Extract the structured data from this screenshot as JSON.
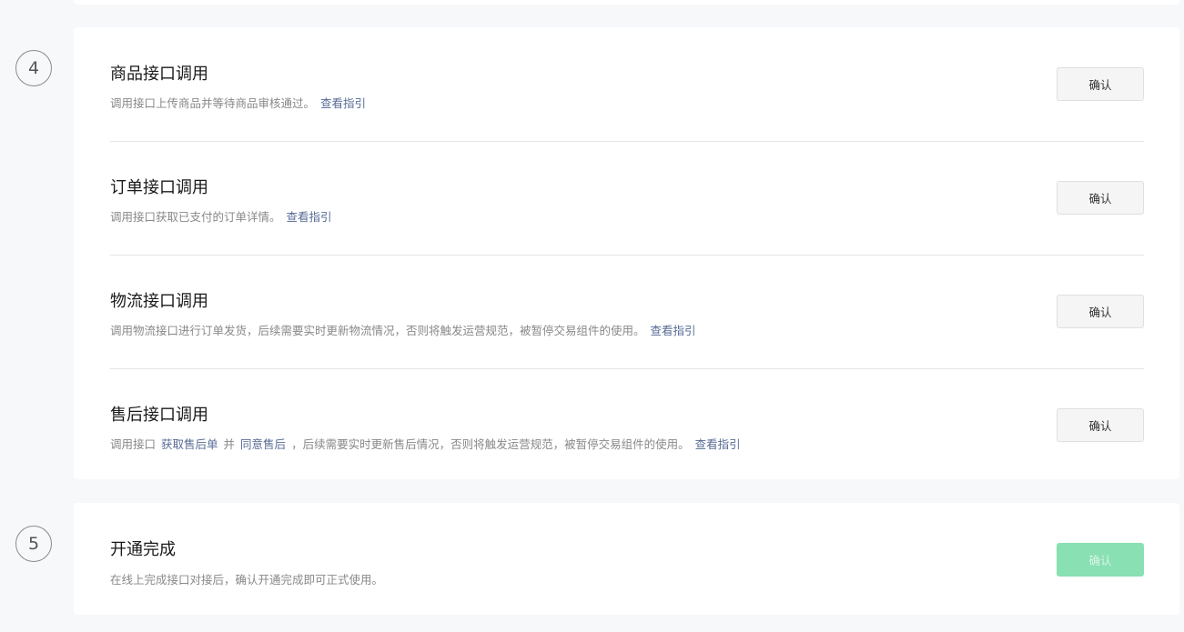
{
  "steps": {
    "step4": {
      "number": "4",
      "rows": [
        {
          "title": "商品接口调用",
          "desc": "调用接口上传商品并等待商品审核通过。",
          "link": "查看指引",
          "button": "确认"
        },
        {
          "title": "订单接口调用",
          "desc": "调用接口获取已支付的订单详情。",
          "link": "查看指引",
          "button": "确认"
        },
        {
          "title": "物流接口调用",
          "desc": "调用物流接口进行订单发货，后续需要实时更新物流情况，否则将触发运营规范，被暂停交易组件的使用。",
          "link": "查看指引",
          "button": "确认"
        },
        {
          "title": "售后接口调用",
          "desc_prefix": "调用接口",
          "link_a": "获取售后单",
          "desc_mid": "并",
          "link_b": "同意售后",
          "desc_suffix": "，后续需要实时更新售后情况，否则将触发运营规范，被暂停交易组件的使用。",
          "link": "查看指引",
          "button": "确认"
        }
      ]
    },
    "step5": {
      "number": "5",
      "title": "开通完成",
      "desc": "在线上完成接口对接后，确认开通完成即可正式使用。",
      "button": "确认",
      "button_state": "disabled"
    }
  },
  "colors": {
    "link": "#576b95",
    "disabled_button": "#89e0b3"
  }
}
